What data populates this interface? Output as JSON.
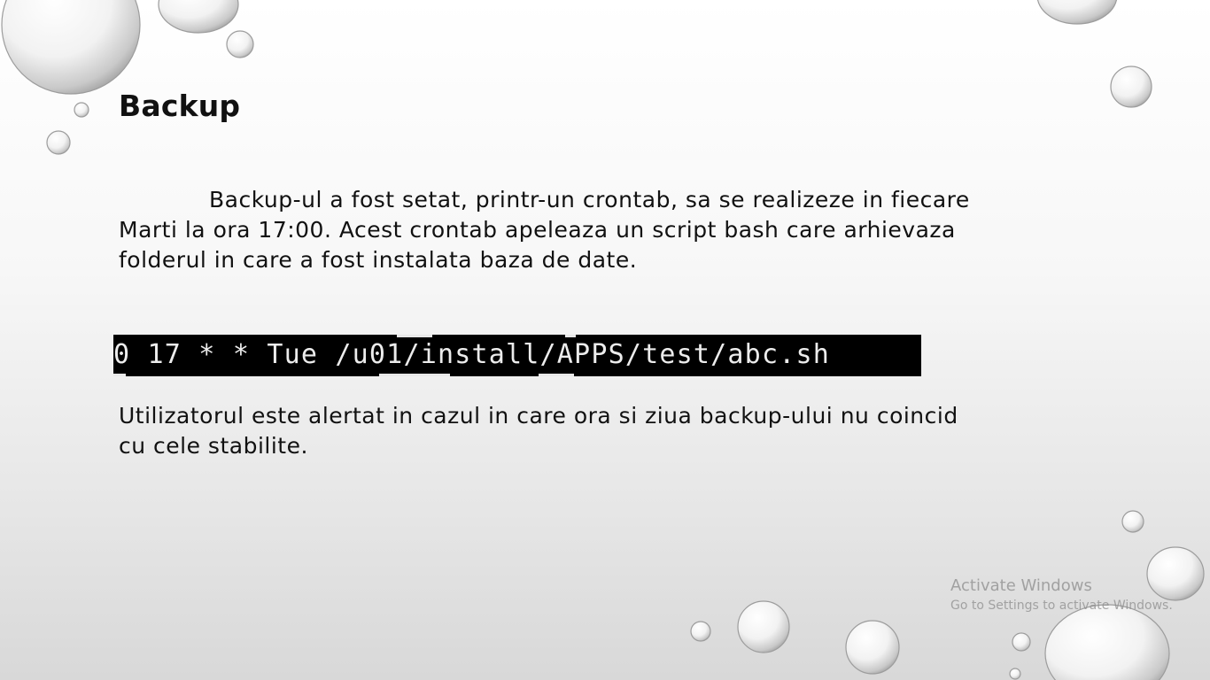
{
  "slide": {
    "title": "Backup",
    "paragraph1": "Backup-ul a fost setat, printr-un crontab, sa se realizeze in fiecare Marti la ora 17:00. Acest crontab apeleaza un script bash care arhievaza folderul in care a fost instalata baza de date.",
    "terminal_line": "0 17 * * Tue /u01/install/APPS/test/abc.sh",
    "paragraph2": "Utilizatorul este alertat in cazul in care ora si ziua backup-ului nu coincid cu cele stabilite."
  },
  "watermark": {
    "title": "Activate Windows",
    "subtitle": "Go to Settings to activate Windows."
  },
  "colors": {
    "background": "#f4f4f4",
    "terminal_bg": "#000000",
    "terminal_fg": "#ececec",
    "watermark": "#8c8c8c"
  }
}
